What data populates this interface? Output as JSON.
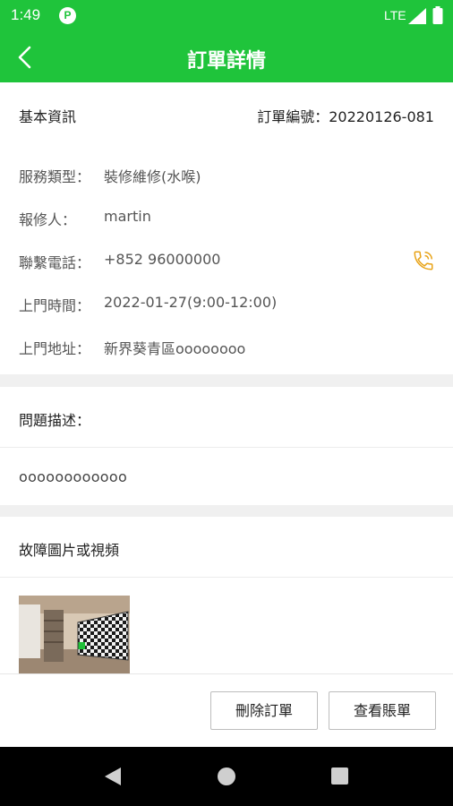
{
  "status_bar": {
    "time": "1:49",
    "notification_glyph": "P",
    "network": "LTE"
  },
  "app_bar": {
    "title": "訂單詳情",
    "back_icon": "chevron-left-icon"
  },
  "basic_info": {
    "section_label": "基本資訊",
    "order_number": "訂單編號：20220126-081",
    "rows": [
      {
        "label": "服務類型：",
        "value": "裝修維修(水喉)"
      },
      {
        "label": "報修人：",
        "value": "martin"
      },
      {
        "label": "聯繫電話：",
        "value": "+852 96000000"
      },
      {
        "label": "上門時間：",
        "value": "2022-01-27(9:00-12:00)"
      },
      {
        "label": "上門地址：",
        "value": "新界葵青區oooooooo"
      }
    ],
    "phone_icon": "phone-icon"
  },
  "problem": {
    "title": "問題描述：",
    "text": "oooooooooooo"
  },
  "media": {
    "title": "故障圖片或視頻"
  },
  "actions": {
    "delete_label": "刪除訂單",
    "bill_label": "查看賬單"
  },
  "colors": {
    "brand_green": "#1fc43b",
    "phone_icon": "#e8a317"
  }
}
